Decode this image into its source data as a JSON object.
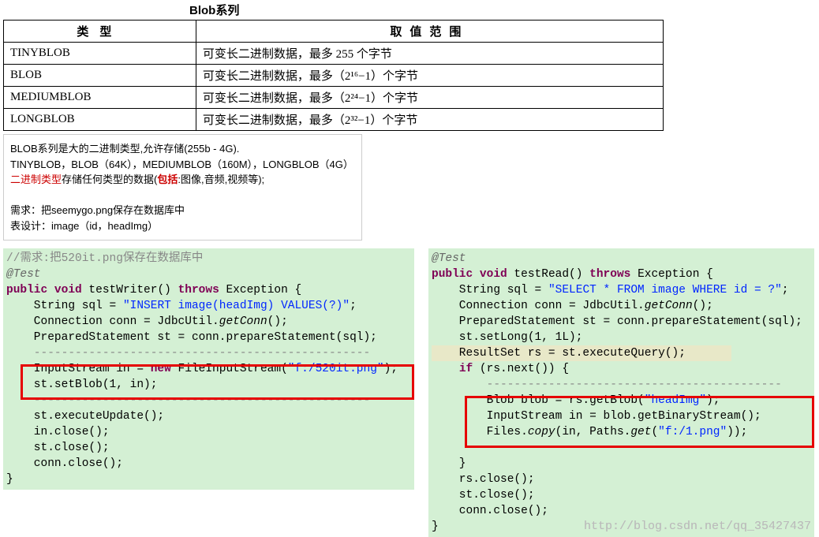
{
  "title": "Blob系列",
  "table": {
    "h1": "类型",
    "h2": "取值范围",
    "rows": [
      {
        "t": "TINYBLOB",
        "v": "可变长二进制数据，最多 255 个字节"
      },
      {
        "t": "BLOB",
        "v": "可变长二进制数据，最多（2¹⁶−1）个字节"
      },
      {
        "t": "MEDIUMBLOB",
        "v": "可变长二进制数据，最多（2²⁴−1）个字节"
      },
      {
        "t": "LONGBLOB",
        "v": "可变长二进制数据，最多（2³²−1）个字节"
      }
    ]
  },
  "note": {
    "l1": "BLOB系列是大的二进制类型,允许存储(255b - 4G).",
    "l2": "TINYBLOB，BLOB（64K），MEDIUMBLOB（160M），LONGBLOB（4G）",
    "l3a": "二进制类型",
    "l3b": "存储任何类型的数据(",
    "l3c": "包括",
    "l3d": ":图像,音频,视频等);",
    "l4": "需求：把seemygo.png保存在数据库中",
    "l5": "表设计：image（id，headImg）"
  },
  "code1": {
    "cmt": "//需求:把520it.png保存在数据库中",
    "ann": "@Test",
    "sig_a": "public",
    "sig_b": "void",
    "sig_c": " testWriter() ",
    "sig_d": "throws",
    "sig_e": " Exception {",
    "l1a": "    String sql = ",
    "l1b": "\"INSERT image(headImg) VALUES(?)\"",
    "l1c": ";",
    "l2a": "    Connection conn = JdbcUtil.",
    "l2b": "getConn",
    "l2c": "();",
    "l3": "    PreparedStatement st = conn.prepareStatement(sql);",
    "dash": "    -------------------------------------------------",
    "l4a": "    InputStream in = ",
    "l4b": "new",
    "l4c": " FileInputStream(",
    "l4d": "\"f:/520it.png\"",
    "l4e": ");",
    "l5": "    st.setBlob(1, in);",
    "l6": "    st.executeUpdate();",
    "l7": "    in.close();",
    "l8": "    st.close();",
    "l9": "    conn.close();",
    "end": "}"
  },
  "code2": {
    "ann": "@Test",
    "sig_a": "public",
    "sig_b": "void",
    "sig_c": " testRead() ",
    "sig_d": "throws",
    "sig_e": " Exception {",
    "l1a": "    String sql = ",
    "l1b": "\"SELECT * FROM image WHERE id = ?\"",
    "l1c": ";",
    "l2a": "    Connection conn = JdbcUtil.",
    "l2b": "getConn",
    "l2c": "();",
    "l3": "    PreparedStatement st = conn.prepareStatement(sql);",
    "l4": "    st.setLong(1, 1L);",
    "l5": "    ResultSet rs = st.executeQuery();",
    "l6a": "if",
    "l6b": " (rs.next()) {",
    "dash1": "        -------------------------------------------",
    "l7a": "        Blob blob = rs.getBlob(",
    "l7b": "\"headImg\"",
    "l7c": ");",
    "l8": "        InputStream in = blob.getBinaryStream();",
    "l9a": "        Files.",
    "l9b": "copy",
    "l9c": "(in, Paths.",
    "l9d": "get",
    "l9e": "(",
    "l9f": "\"f:/1.png\"",
    "l9g": "));",
    "dash2": "        -------------------------------------------",
    "l10": "    }",
    "l11": "    rs.close();",
    "l12": "    st.close();",
    "l13": "    conn.close();",
    "end": "}"
  },
  "watermark": "http://blog.csdn.net/qq_35427437"
}
